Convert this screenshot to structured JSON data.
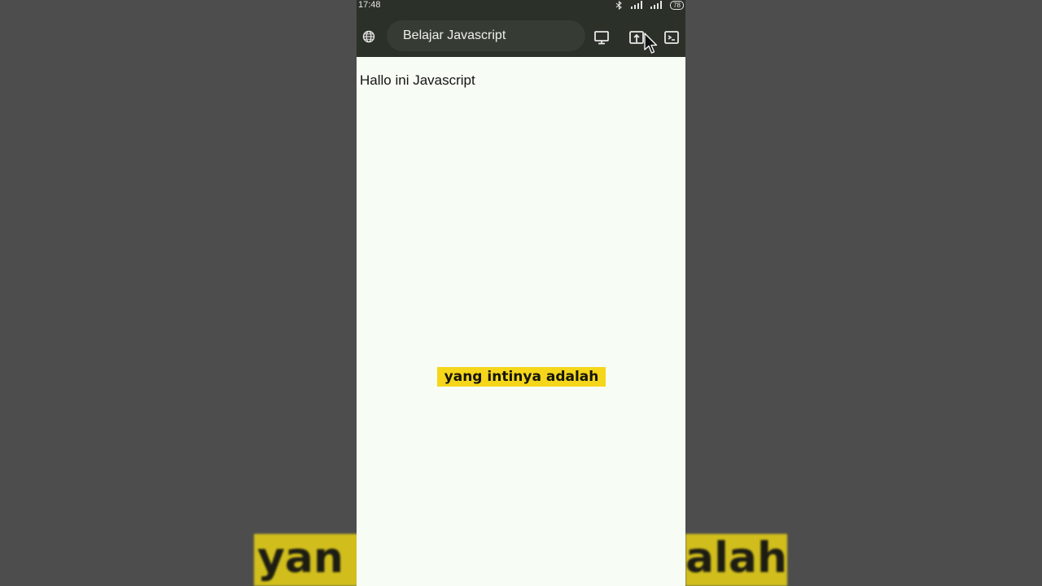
{
  "status_bar": {
    "time": "17:48",
    "battery": "78",
    "icons": [
      "bluetooth-icon",
      "signal-icon",
      "signal-icon"
    ]
  },
  "browser": {
    "page_title": "Belajar Javascript",
    "icons": [
      "globe-icon",
      "desktop-icon",
      "open-tab-icon",
      "console-icon"
    ]
  },
  "page": {
    "body_text": "Hallo ini Javascript"
  },
  "caption": {
    "text": "yang intinya adalah",
    "bg_left_text": "yan",
    "bg_right_text": "alah"
  },
  "colors": {
    "toolbar": "#2b3029",
    "page_bg": "#f7fdf4",
    "caption_bg": "#f5d61a",
    "surround": "#4d4d4d"
  }
}
